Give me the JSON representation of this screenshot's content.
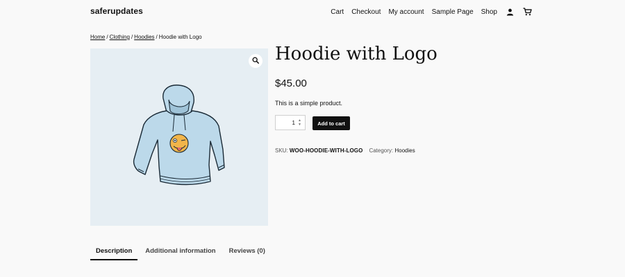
{
  "header": {
    "site_title": "saferupdates",
    "nav": [
      {
        "label": "Cart"
      },
      {
        "label": "Checkout"
      },
      {
        "label": "My account"
      },
      {
        "label": "Sample Page"
      },
      {
        "label": "Shop"
      }
    ],
    "icons": [
      "user-icon",
      "cart-icon"
    ]
  },
  "breadcrumb": {
    "items": [
      "Home",
      "Clothing",
      "Hoodies"
    ],
    "separator": "/",
    "current": "Hoodie with Logo"
  },
  "product": {
    "title": "Hoodie with Logo",
    "price": "$45.00",
    "short_description": "This is a simple product.",
    "quantity": "1",
    "add_to_cart_label": "Add to cart",
    "sku_label": "SKU:",
    "sku": "WOO-HOODIE-WITH-LOGO",
    "category_label": "Category:",
    "category": "Hoodies",
    "image_bg_color": "#e6eef3",
    "hoodie_color": "#bcd9ea",
    "logo_color": "#f2b54a"
  },
  "tabs": [
    {
      "label": "Description",
      "active": true
    },
    {
      "label": "Additional information",
      "active": false
    },
    {
      "label": "Reviews (0)",
      "active": false
    }
  ]
}
